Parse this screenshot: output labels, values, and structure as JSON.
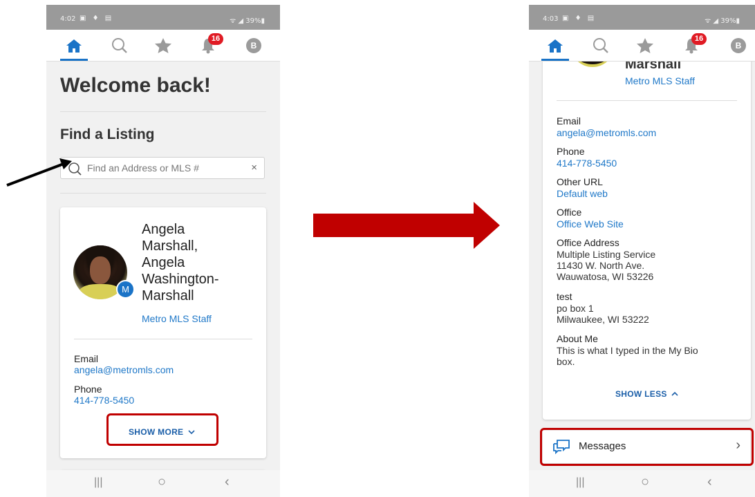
{
  "left_screen": {
    "status": {
      "time": "4:02",
      "battery": "39%"
    },
    "nav": {
      "badge_count": "16",
      "avatar_letter": "B"
    },
    "welcome": "Welcome back!",
    "find_title": "Find a Listing",
    "search": {
      "placeholder": "Find an Address or MLS #",
      "clear": "×"
    },
    "profile": {
      "name_lines": [
        "Angela",
        "Marshall,",
        "Angela",
        "Washington-",
        "Marshall"
      ],
      "badge_letter": "M",
      "staff": "Metro MLS Staff",
      "email_label": "Email",
      "email": "angela@metromls.com",
      "phone_label": "Phone",
      "phone": "414-778-5450",
      "toggle": "SHOW MORE"
    }
  },
  "right_screen": {
    "status": {
      "time": "4:03",
      "battery": "39%"
    },
    "nav": {
      "badge_count": "16",
      "avatar_letter": "B"
    },
    "profile": {
      "name_partial": "Marshall",
      "staff": "Metro MLS Staff",
      "fields": [
        {
          "label": "Email",
          "value": "angela@metromls.com",
          "link": true
        },
        {
          "label": "Phone",
          "value": "414-778-5450",
          "link": true
        },
        {
          "label": "Other URL",
          "value": "Default web",
          "link": true
        },
        {
          "label": "Office",
          "value": "Office Web Site",
          "link": true
        },
        {
          "label": "Office Address",
          "value": "Multiple Listing Service\n11430 W. North Ave.\nWauwatosa, WI 53226",
          "link": false
        },
        {
          "label": "test",
          "value": "po box 1\nMilwaukee, WI 53222",
          "link": false
        },
        {
          "label": "About Me",
          "value": "This is what I typed in the My Bio\nbox.",
          "link": false
        }
      ],
      "toggle": "SHOW LESS"
    },
    "messages": {
      "label": "Messages"
    }
  },
  "colors": {
    "accent": "#1a73c7",
    "link": "#1f78c8",
    "highlight": "#c00000",
    "badge": "#e01b24"
  }
}
